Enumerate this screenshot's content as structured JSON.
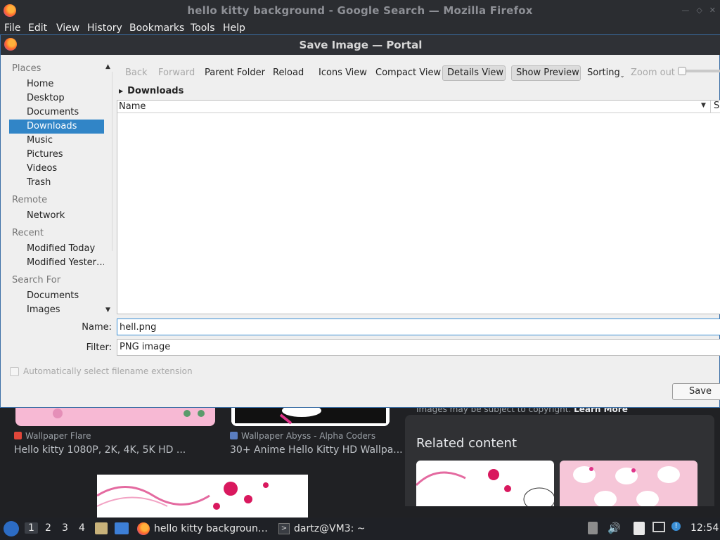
{
  "firefox": {
    "title": "hello kitty background - Google Search — Mozilla Firefox",
    "menu": [
      "File",
      "Edit",
      "View",
      "History",
      "Bookmarks",
      "Tools",
      "Help"
    ]
  },
  "dialog": {
    "title": "Save Image — Portal",
    "places": {
      "headings": {
        "places": "Places",
        "remote": "Remote",
        "recent": "Recent",
        "search": "Search For"
      },
      "places_items": [
        "Home",
        "Desktop",
        "Documents",
        "Downloads",
        "Music",
        "Pictures",
        "Videos",
        "Trash"
      ],
      "remote_items": [
        "Network"
      ],
      "recent_items": [
        "Modified Today",
        "Modified Yester…"
      ],
      "search_items": [
        "Documents",
        "Images"
      ],
      "selected": "Downloads"
    },
    "toolbar": {
      "back": "Back",
      "forward": "Forward",
      "parent": "Parent Folder",
      "reload": "Reload",
      "icons_view": "Icons View",
      "compact_view": "Compact View",
      "details_view": "Details View",
      "show_preview": "Show Preview",
      "sorting": "Sorting",
      "zoom_out": "Zoom out"
    },
    "breadcrumb": "Downloads",
    "list": {
      "col_name": "Name",
      "col_size": "Si"
    },
    "name_label": "Name:",
    "name_value": "hell.png",
    "filter_label": "Filter:",
    "filter_value": "PNG image",
    "auto_ext": "Automatically select filename extension",
    "save": "Save"
  },
  "background": {
    "results": [
      {
        "source": "Wallpaper Flare",
        "title": "Hello kitty 1080P, 2K, 4K, 5K HD ..."
      },
      {
        "source": "Wallpaper Abyss - Alpha Coders",
        "title": "30+ Anime Hello Kitty HD Wallpa..."
      }
    ],
    "copyright": "Images may be subject to copyright.",
    "learn_more": "Learn More",
    "related": "Related content"
  },
  "taskbar": {
    "workspaces": [
      "1",
      "2",
      "3",
      "4"
    ],
    "tasks": [
      "hello kitty backgroun…",
      "dartz@VM3: ~"
    ],
    "clock": "12:54"
  },
  "colors": {
    "selection": "#3185c7",
    "focus": "#3a8fd6",
    "titlebar": "#2f3136"
  }
}
